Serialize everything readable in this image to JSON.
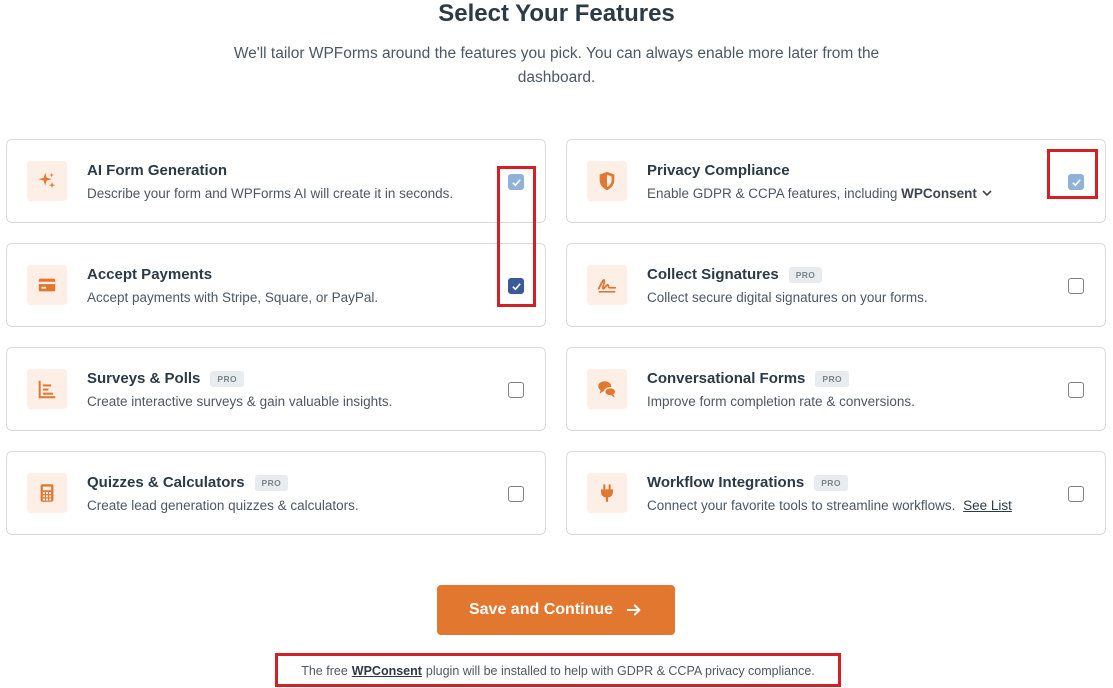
{
  "header": {
    "title": "Select Your Features",
    "subtitle": "We'll tailor WPForms around the features you pick. You can always enable more later from the dashboard."
  },
  "features": [
    {
      "title": "AI Form Generation",
      "desc": "Describe your form and WPForms AI will create it in seconds.",
      "icon": "sparkle-icon",
      "pro": false,
      "checked": true
    },
    {
      "title": "Privacy Compliance",
      "desc_prefix": "Enable GDPR & CCPA features, including",
      "desc_link": "WPConsent",
      "icon": "shield-icon",
      "pro": false,
      "checked": true
    },
    {
      "title": "Accept Payments",
      "desc": "Accept payments with Stripe, Square, or PayPal.",
      "icon": "credit-card-icon",
      "pro": false,
      "checked": true
    },
    {
      "title": "Collect Signatures",
      "desc": "Collect secure digital signatures on your forms.",
      "icon": "signature-icon",
      "pro": true,
      "checked": false
    },
    {
      "title": "Surveys & Polls",
      "desc": "Create interactive surveys & gain valuable insights.",
      "icon": "chart-icon",
      "pro": true,
      "checked": false
    },
    {
      "title": "Conversational Forms",
      "desc": "Improve form completion rate & conversions.",
      "icon": "chat-icon",
      "pro": true,
      "checked": false
    },
    {
      "title": "Quizzes & Calculators",
      "desc": "Create lead generation quizzes & calculators.",
      "icon": "calculator-icon",
      "pro": true,
      "checked": false
    },
    {
      "title": "Workflow Integrations",
      "desc_prefix": "Connect your favorite tools to streamline workflows.",
      "desc_link": "See List",
      "icon": "plug-icon",
      "pro": true,
      "checked": false
    }
  ],
  "pro_label": "PRO",
  "cta": {
    "label": "Save and Continue",
    "icon": "arrow-right-icon"
  },
  "footnote": {
    "prefix": "The free",
    "link": "WPConsent",
    "suffix": "plugin will be installed to help with GDPR & CCPA privacy compliance."
  },
  "colors": {
    "accent": "#e27730",
    "icon_bg": "#fdeee6",
    "checked": "#3b5a9a",
    "highlight": "#d32027"
  }
}
